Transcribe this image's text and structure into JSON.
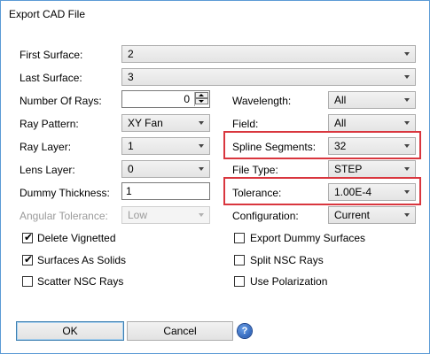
{
  "window": {
    "title": "Export CAD File"
  },
  "left": {
    "first_surface": {
      "label": "First Surface:",
      "value": "2"
    },
    "last_surface": {
      "label": "Last Surface:",
      "value": "3"
    },
    "number_of_rays": {
      "label": "Number Of Rays:",
      "value": "0"
    },
    "ray_pattern": {
      "label": "Ray Pattern:",
      "value": "XY Fan"
    },
    "ray_layer": {
      "label": "Ray Layer:",
      "value": "1"
    },
    "lens_layer": {
      "label": "Lens Layer:",
      "value": "0"
    },
    "dummy_thickness": {
      "label": "Dummy Thickness:",
      "value": "1"
    },
    "angular_tolerance": {
      "label": "Angular Tolerance:",
      "value": "Low"
    }
  },
  "right": {
    "wavelength": {
      "label": "Wavelength:",
      "value": "All"
    },
    "field": {
      "label": "Field:",
      "value": "All"
    },
    "spline_segments": {
      "label": "Spline Segments:",
      "value": "32"
    },
    "file_type": {
      "label": "File Type:",
      "value": "STEP"
    },
    "tolerance": {
      "label": "Tolerance:",
      "value": "1.00E-4"
    },
    "configuration": {
      "label": "Configuration:",
      "value": "Current"
    }
  },
  "checkboxes": {
    "delete_vignetted": {
      "label": "Delete Vignetted",
      "checked": true
    },
    "surfaces_as_solids": {
      "label": "Surfaces As Solids",
      "checked": true
    },
    "scatter_nsc_rays": {
      "label": "Scatter NSC Rays",
      "checked": false
    },
    "export_dummy_surfaces": {
      "label": "Export Dummy Surfaces",
      "checked": false
    },
    "split_nsc_rays": {
      "label": "Split NSC Rays",
      "checked": false
    },
    "use_polarization": {
      "label": "Use Polarization",
      "checked": false
    }
  },
  "buttons": {
    "ok": "OK",
    "cancel": "Cancel",
    "help_glyph": "?"
  },
  "colors": {
    "highlight": "#d9363e",
    "window_border": "#5b9bd5"
  }
}
